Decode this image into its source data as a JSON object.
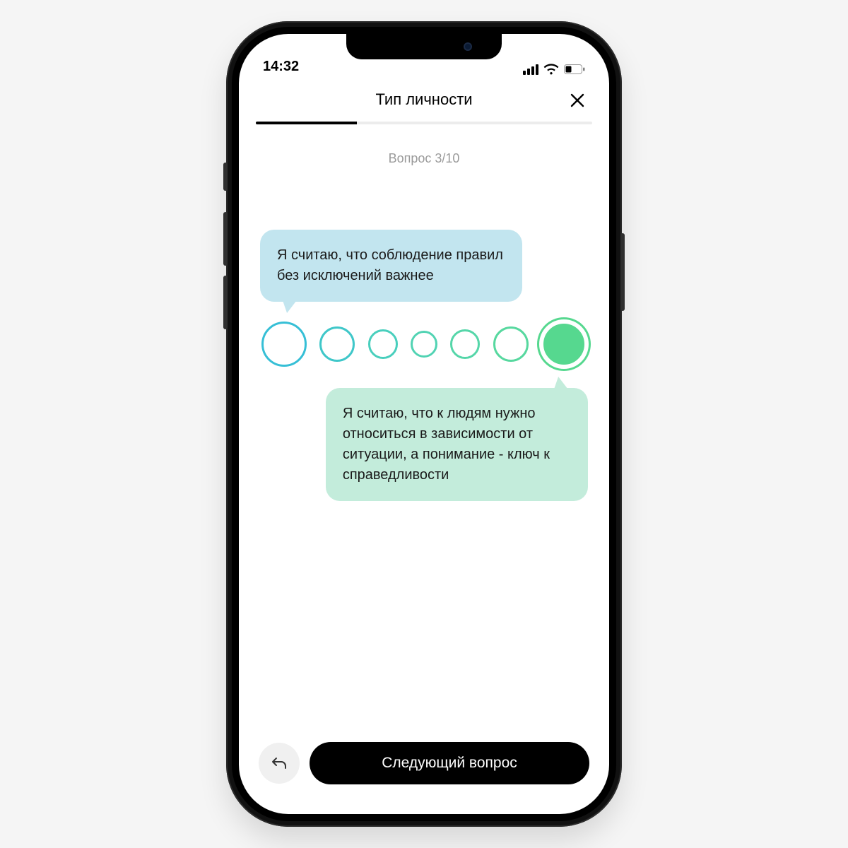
{
  "status": {
    "time": "14:32"
  },
  "header": {
    "title": "Тип личности",
    "close_label": "Close"
  },
  "progress": {
    "percent": 30
  },
  "step": {
    "label": "Вопрос 3/10",
    "current": 3,
    "total": 10
  },
  "question": {
    "option_a": "Я считаю, что соблюдение правил без исключений важнее",
    "option_b": "Я считаю, что к людям нужно относиться в зависимости от ситуации, а понимание - ключ к справедливости"
  },
  "likert": {
    "count": 7,
    "selected_index": 6,
    "left_color": "#36bfd6",
    "right_color": "#56d88f"
  },
  "footer": {
    "back_label": "Назад",
    "next_label": "Следующий вопрос"
  }
}
